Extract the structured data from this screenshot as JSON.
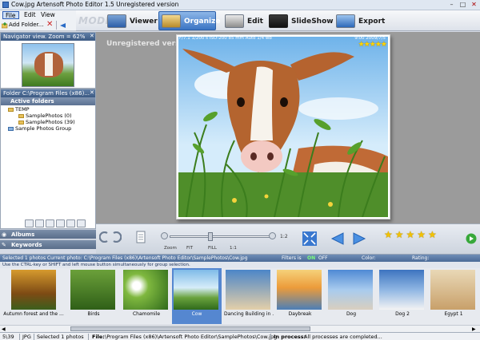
{
  "titlebar": {
    "title": "Cow.jpg   Artensoft Photo Editor 1.5  Unregistered version"
  },
  "menu": {
    "file": "File",
    "edit": "Edit",
    "view": "View"
  },
  "toolbar": {
    "add_folder": "Add Folder..."
  },
  "modes": {
    "label": "MODE:",
    "items": [
      {
        "label": "Viewer"
      },
      {
        "label": "Organize"
      },
      {
        "label": "Edit"
      },
      {
        "label": "SlideShow"
      },
      {
        "label": "Export"
      }
    ],
    "active": "Organize"
  },
  "navigator": {
    "title": "Navigator view. Zoom = 62%"
  },
  "folders": {
    "path_title": "Folder C:\\Program Files (x86)...",
    "active_label": "Active folders",
    "tree": [
      {
        "label": "TEMP"
      },
      {
        "label": "SamplePhotos (0)"
      },
      {
        "label": "SamplePhotos (39)"
      },
      {
        "label": "Sample Photos Group"
      }
    ]
  },
  "sections": {
    "albums": "Albums",
    "keywords": "Keywords"
  },
  "viewer": {
    "watermark": "Unregistered version",
    "photo_meta": "F/7.1  1/200 s  ISO-200  85 mm  Auto 1/4 wb",
    "photo_date": "9:00 2009/7/5",
    "rating": "★★★★★"
  },
  "zoombar": {
    "zoom": "Zoom",
    "fit": "FIT",
    "fill": "FILL",
    "one_to_one": "1:1",
    "ratio": "1:2"
  },
  "thumbs": {
    "selected_info": "Selected 1  photos    Current photo:  C:\\Program Files (x86)\\Artensoft Photo Editor\\SamplePhotos\\Cow.jpg",
    "hint": "Use the CTRL-key or SHIFT and  left mouse button simultaneously for group selection.",
    "filters_label": "Filters is",
    "filters_state": "ON",
    "filters_off": "OFF",
    "color_label": "Color:",
    "rating_label": "Rating:",
    "items": [
      {
        "caption": "Autumn forest and the ..."
      },
      {
        "caption": "Birds"
      },
      {
        "caption": "Chamomile"
      },
      {
        "caption": "Cow"
      },
      {
        "caption": "Dancing Building in ..."
      },
      {
        "caption": "Daybreak"
      },
      {
        "caption": "Dog"
      },
      {
        "caption": "Dog 2"
      },
      {
        "caption": "Egypt 1"
      }
    ]
  },
  "status": {
    "count": "5\\39",
    "format": "JPG",
    "selected": "Selected 1 photos",
    "file_label": "File:",
    "file_path": "\\Program Files (x86)\\Artensoft Photo Editor\\SamplePhotos\\Cow.jpg",
    "process_label": "In process:",
    "process_text": "All processes are completed..."
  }
}
